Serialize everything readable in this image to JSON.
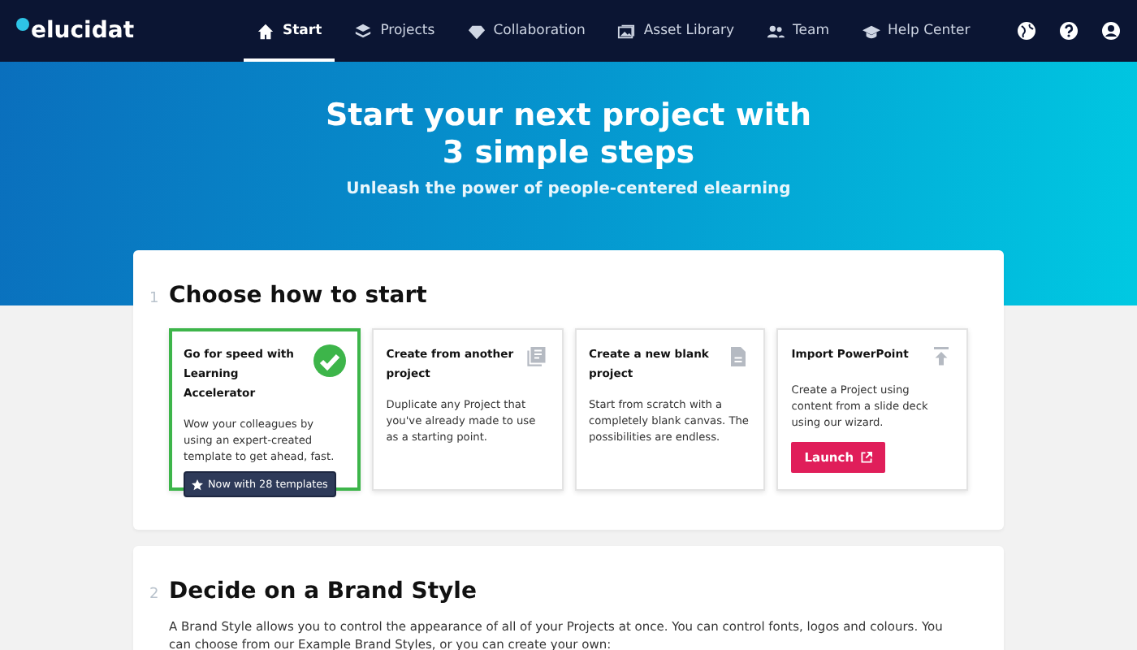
{
  "brand": "elucidat",
  "nav": [
    {
      "label": "Start",
      "selected": true
    },
    {
      "label": "Projects",
      "selected": false
    },
    {
      "label": "Collaboration",
      "selected": false
    },
    {
      "label": "Asset Library",
      "selected": false
    },
    {
      "label": "Team",
      "selected": false
    },
    {
      "label": "Help Center",
      "selected": false
    }
  ],
  "hero": {
    "title": "Start your next project with 3 simple steps",
    "subtitle": "Unleash the power of people-centered elearning"
  },
  "steps": [
    {
      "number": "1",
      "title": "Choose how to start",
      "options": [
        {
          "title": "Go for speed with Learning Accelerator",
          "text": "Wow your colleagues by using an expert-created template to get ahead, fast.",
          "selected": true,
          "action": {
            "kind": "badge",
            "label": "Now with 28 templates"
          }
        },
        {
          "title": "Create from another project",
          "text": "Duplicate any Project that you've already made to use as a starting point.",
          "selected": false
        },
        {
          "title": "Create a new blank project",
          "text": "Start from scratch with a completely blank canvas. The possibilities are endless.",
          "selected": false
        },
        {
          "title": "Import PowerPoint",
          "text": "Create a Project using content from a slide deck using our wizard.",
          "selected": false,
          "action": {
            "kind": "launch",
            "label": "Launch"
          }
        }
      ]
    },
    {
      "number": "2",
      "title": "Decide on a Brand Style",
      "text": "A Brand Style allows you to control the appearance of all of your Projects at once. You can control fonts, logos and colours. You can choose from our Example Brand Styles, or you can create your own:"
    }
  ]
}
